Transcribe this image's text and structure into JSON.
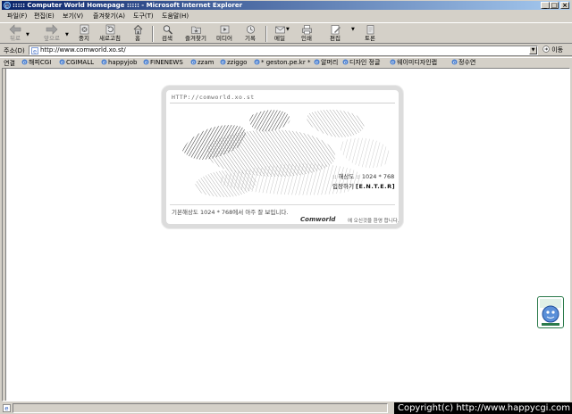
{
  "window": {
    "title": "::::: Computer World Homepage ::::: - Microsoft Internet Explorer",
    "controls": {
      "minimize": "_",
      "maximize": "□",
      "close": "×"
    }
  },
  "menu": {
    "items": [
      "파일(F)",
      "편집(E)",
      "보기(V)",
      "즐겨찾기(A)",
      "도구(T)",
      "도움말(H)"
    ]
  },
  "toolbar": {
    "back": "뒤로",
    "forward": "앞으로",
    "stop": "중지",
    "refresh": "새로고침",
    "home": "홈",
    "search": "검색",
    "favorites": "즐겨찾기",
    "media": "미디어",
    "history": "기록",
    "mail": "메일",
    "print": "인쇄",
    "edit": "편집",
    "discuss": "토론"
  },
  "address": {
    "label": "주소(D)",
    "url": "http://www.comworld.xo.st/",
    "go": "이동"
  },
  "links": {
    "label": "연결",
    "items": [
      "해피CGI",
      "CGIMALL",
      "happyjob",
      "FINENEWS",
      "zzam",
      "zziggo",
      "* geston.pe.kr *",
      "알머리",
      "디자인 정글",
      "웨이미디자인랩",
      "정수연"
    ]
  },
  "page": {
    "card_url": "HTTP://comworld.xo.st",
    "resolution_label": ":: 해상도 :: 1024 * 768",
    "enter_prefix": "입장하기",
    "enter_label": "[E.N.T.E.R]",
    "hint": "기본해상도 1024 * 768에서 아주 잘 보입니다.",
    "logo": "Comworld",
    "slogan": "에 오신것을 환영 합니다."
  },
  "status": {
    "copyright": "Copyright(c) http://www.happycgi.com"
  },
  "colors": {
    "titlebar_start": "#0a246a",
    "titlebar_end": "#a6caf0",
    "chrome": "#d4d0c8",
    "badge": "#2a7a4a"
  }
}
